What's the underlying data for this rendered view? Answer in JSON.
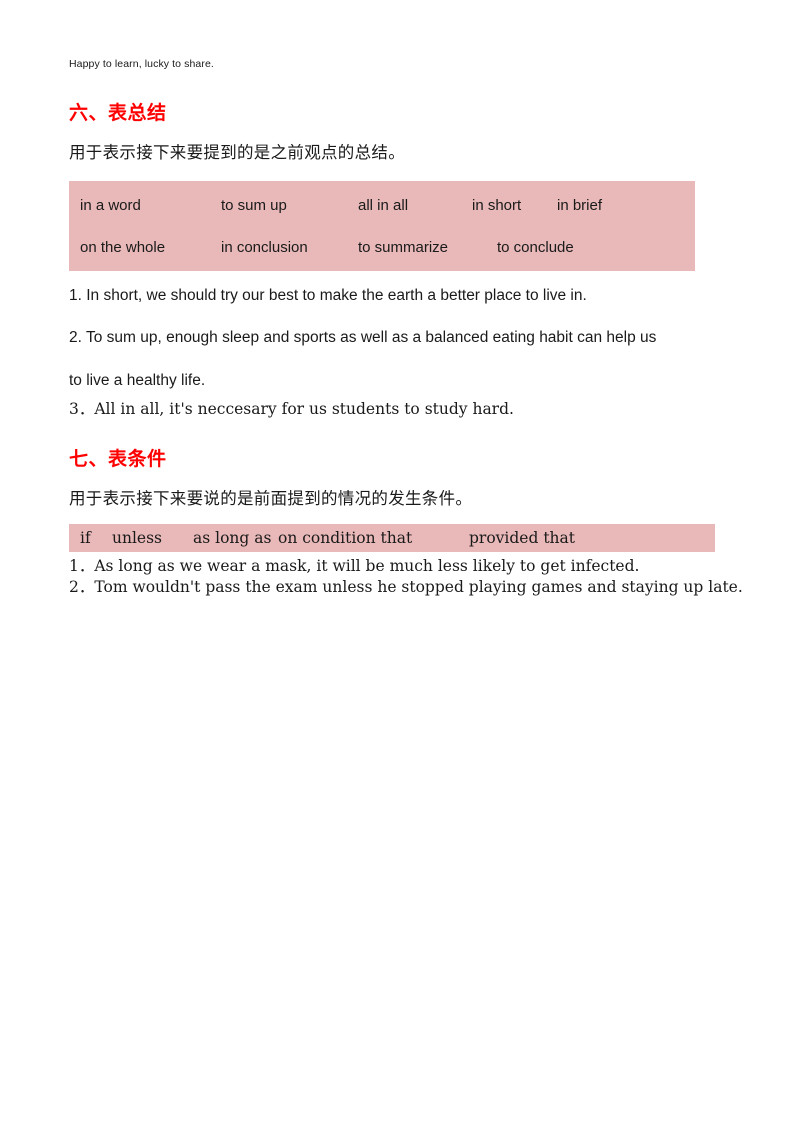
{
  "document": {
    "running_header": "Happy to learn, lucky to share.",
    "sections": [
      {
        "heading": "六、表总结",
        "description": "用于表示接下来要提到的是之前观点的总结。",
        "phrase_rows": [
          [
            "in a word",
            "to sum up",
            "all in all",
            "in short",
            "in brief"
          ],
          [
            "on the whole",
            "in conclusion",
            "to summarize",
            "to conclude"
          ]
        ],
        "examples": [
          "1. In short, we should try our best to make the earth a better place to live in.",
          "2. To sum up, enough sleep and sports as well as a balanced eating habit can help us",
          "to live a healthy life.",
          "3．All in all, it's neccesary for us students to study hard."
        ]
      },
      {
        "heading": "七、表条件",
        "description": "用于表示接下来要说的是前面提到的情况的发生条件。",
        "phrase_rows": [
          [
            "if",
            "unless",
            "as long as",
            "on condition that",
            "provided that"
          ]
        ],
        "examples": [
          "1．As long as we wear a mask, it will be much less likely to get infected.",
          "2．Tom wouldn't pass the exam unless he stopped playing games and staying up late."
        ]
      }
    ],
    "colors": {
      "heading": "#ff0000",
      "phrase_box": "#e9b8b8",
      "text": "#1a1a1a",
      "page_background": "#ffffff"
    }
  }
}
